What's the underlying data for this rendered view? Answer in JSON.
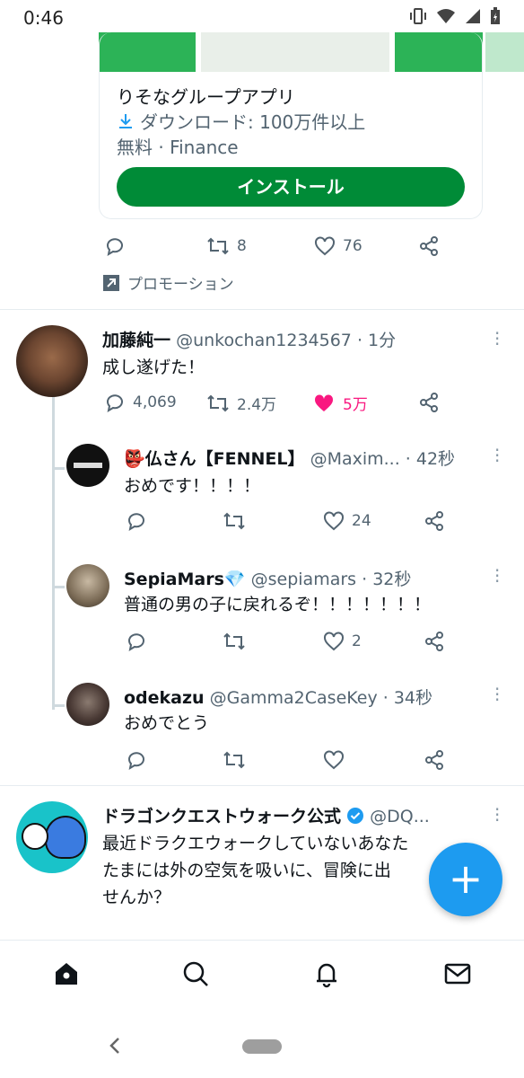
{
  "status_bar": {
    "time": "0:46"
  },
  "promo": {
    "app_name": "りそなグループアプリ",
    "downloads": "ダウンロード: 100万件以上",
    "category": "無料 · Finance",
    "install_label": "インストール",
    "retweets": "8",
    "likes": "76",
    "promotion_label": "プロモーション"
  },
  "main_tweet": {
    "name": "加藤純一",
    "handle": "@unkochan1234567",
    "time": "· 1分",
    "text": "成し遂げた！",
    "replies": "4,069",
    "retweets": "2.4万",
    "likes": "5万"
  },
  "replies": [
    {
      "name": "👺仏さん【FENNEL】",
      "handle": "@Maxim...",
      "time": "· 42秒",
      "text": "おめです！！！！",
      "likes": "24"
    },
    {
      "name": "SepiaMars💎",
      "handle": "@sepiamars",
      "time": "· 32秒",
      "text": "普通の男の子に戻れるぞ！！！！！！！",
      "likes": "2"
    },
    {
      "name": "odekazu",
      "handle": "@Gamma2CaseKey",
      "time": "· 34秒",
      "text": "おめでとう",
      "likes": ""
    }
  ],
  "next_tweet": {
    "name": "ドラゴンクエストウォーク公式",
    "handle": "@DQ...",
    "text_line1": "最近ドラクエウォークしていないあなた",
    "text_line2": "たまには外の空気を吸いに、冒険に出",
    "text_line3": "せんか？"
  },
  "fab": {
    "label": "+"
  },
  "colors": {
    "accent": "#1d9bf0",
    "install": "#008b37",
    "like": "#f91880"
  },
  "icons": [
    "wifi-icon",
    "signal-icon",
    "battery-icon",
    "vibrate-icon",
    "reply-icon",
    "retweet-icon",
    "like-icon",
    "share-icon",
    "more-icon",
    "home-icon",
    "search-icon",
    "bell-icon",
    "mail-icon"
  ]
}
